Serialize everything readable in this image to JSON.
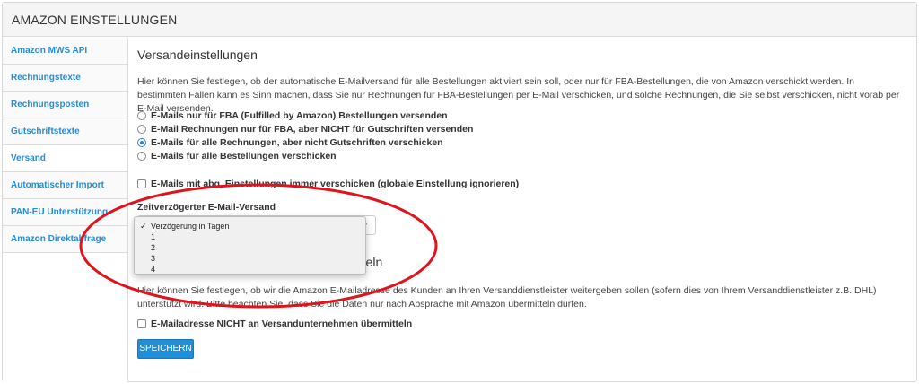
{
  "header": {
    "title": "AMAZON EINSTELLUNGEN"
  },
  "sidebar": {
    "items": [
      {
        "label": "Amazon MWS API",
        "active": false
      },
      {
        "label": "Rechnungstexte",
        "active": false
      },
      {
        "label": "Rechnungsposten",
        "active": false
      },
      {
        "label": "Gutschriftstexte",
        "active": false
      },
      {
        "label": "Versand",
        "active": true
      },
      {
        "label": "Automatischer Import",
        "active": false
      },
      {
        "label": "PAN-EU Unterstützung",
        "active": false
      },
      {
        "label": "Amazon Direktabfrage",
        "active": false
      }
    ]
  },
  "shipping": {
    "title": "Versandeinstellungen",
    "description": "Hier können Sie festlegen, ob der automatische E-Mailversand für alle Bestellungen aktiviert sein soll, oder nur für FBA-Bestellungen, die von Amazon verschickt werden. In bestimmten Fällen kann es Sinn machen, dass Sie nur Rechnungen für FBA-Bestellungen per E-Mail verschicken, und solche Rechnungen, die Sie selbst verschicken, nicht vorab per E-Mail versenden.",
    "options": [
      {
        "label": "E-Mails nur für FBA (Fulfilled by Amazon) Bestellungen versenden",
        "checked": false
      },
      {
        "label": "E-Mail Rechnungen nur für FBA, aber NICHT für Gutschriften versenden",
        "checked": false
      },
      {
        "label": "E-Mails für alle Rechnungen, aber nicht Gutschriften verschicken",
        "checked": true
      },
      {
        "label": "E-Mails für alle Bestellungen verschicken",
        "checked": false
      }
    ],
    "override_checkbox": "E-Mails mit abg. Einstellungen immer verschicken (globale Einstellung ignorieren)",
    "delay_label": "Zeitverzögerter E-Mail-Versand",
    "delay_options": [
      "Verzögerung in Tagen",
      "1",
      "2",
      "3",
      "4"
    ],
    "delay_selected": "Verzögerung in Tagen"
  },
  "email_section": {
    "title_visible": "mitteln",
    "description": "Hier können Sie festlegen, ob wir die Amazon E-Mailadresse des Kunden an Ihren Versanddienstleister weitergeben sollen (sofern dies von Ihrem Versanddienstleister z.B. DHL) unterstützt wird. Bitte beachten Sie, dass Sie die Daten nur nach Absprache mit Amazon übermitteln dürfen.",
    "checkbox_label": "E-Mailadresse NICHT an Versandunternehmen übermitteln"
  },
  "save_label": "SPEICHERN",
  "colors": {
    "accent": "#1e8fd8",
    "link": "#2a8ad0",
    "annotation": "#e0141e"
  }
}
